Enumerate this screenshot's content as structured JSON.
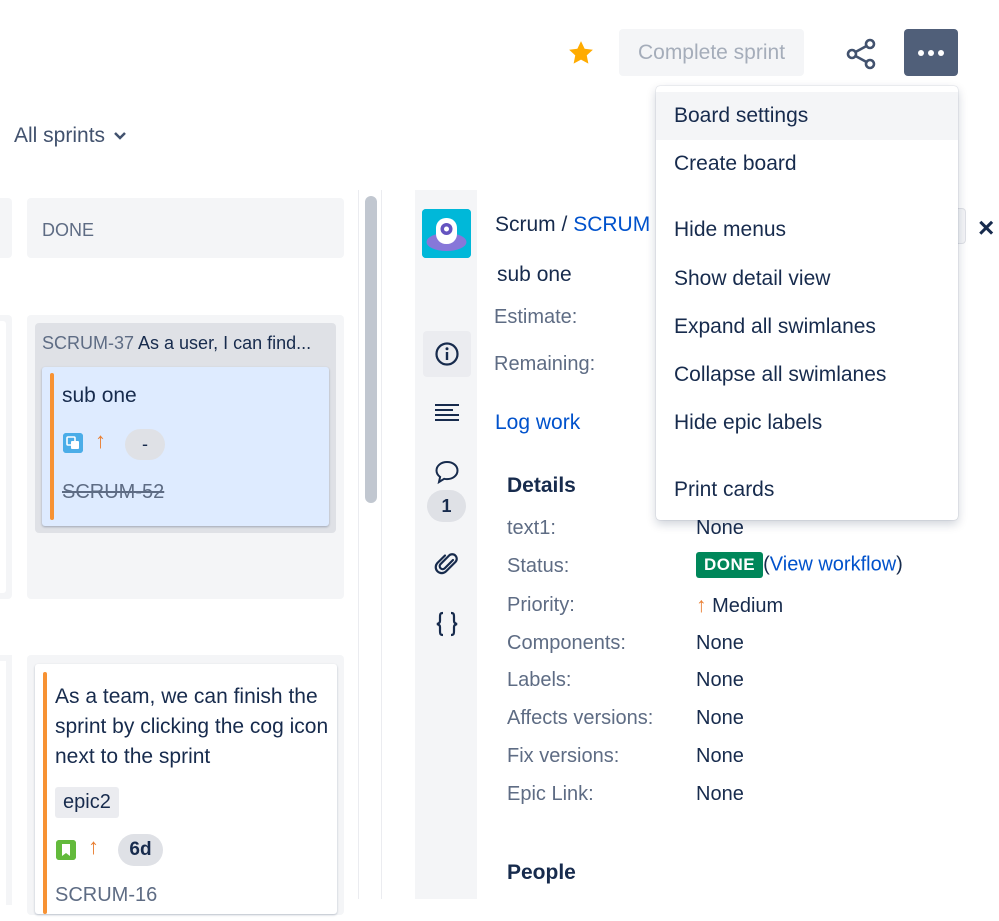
{
  "header": {
    "complete_sprint_label": "Complete sprint",
    "sprint_filter_label": "All sprints"
  },
  "board": {
    "done_column_label": "DONE",
    "parent_card": {
      "key": "SCRUM-37",
      "summary": "As a user, I can find..."
    },
    "subtask_card": {
      "title": "sub one",
      "priority_glyph": "↑",
      "estimate": "-",
      "key": "SCRUM-52"
    },
    "story_card": {
      "title": "As a team, we can finish the sprint by clicking the cog icon next to the sprint",
      "epic": "epic2",
      "priority_glyph": "↑",
      "estimate": "6d",
      "key": "SCRUM-16"
    }
  },
  "detail": {
    "breadcrumb_project": "Scrum",
    "breadcrumb_sep": "/",
    "breadcrumb_key": "SCRUM",
    "issue_title": "sub one",
    "estimate_label": "Estimate:",
    "remaining_label": "Remaining:",
    "log_work_label": "Log work",
    "comment_count": "1",
    "details_heading": "Details",
    "people_heading": "People",
    "fields": {
      "text1_label": "text1:",
      "text1_value": "None",
      "status_label": "Status:",
      "status_value": "DONE",
      "view_workflow_open": "(",
      "view_workflow_label": "View workflow",
      "view_workflow_close": ")",
      "priority_label": "Priority:",
      "priority_glyph": "↑",
      "priority_value": "Medium",
      "components_label": "Components:",
      "components_value": "None",
      "labels_label": "Labels:",
      "labels_value": "None",
      "affects_label": "Affects versions:",
      "affects_value": "None",
      "fix_label": "Fix versions:",
      "fix_value": "None",
      "epic_link_label": "Epic Link:",
      "epic_link_value": "None"
    },
    "close_glyph": "×"
  },
  "menu": {
    "items": [
      {
        "label": "Board settings"
      },
      {
        "label": "Create board"
      },
      {
        "label": "Hide menus"
      },
      {
        "label": "Show detail view"
      },
      {
        "label": "Expand all swimlanes"
      },
      {
        "label": "Collapse all swimlanes"
      },
      {
        "label": "Hide epic labels"
      },
      {
        "label": "Print cards"
      }
    ]
  },
  "colors": {
    "accent": "#0052cc",
    "status_done": "#00875a",
    "priority_medium": "#e97f33",
    "star": "#ffab00"
  }
}
